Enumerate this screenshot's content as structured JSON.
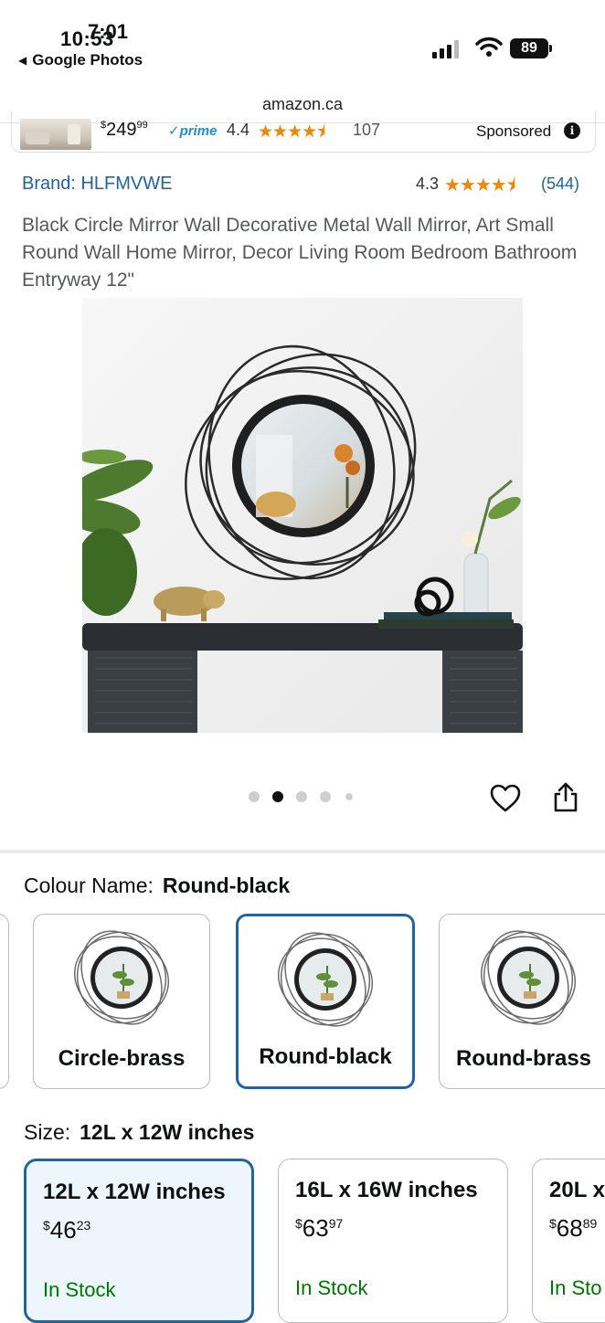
{
  "status_bar": {
    "time_back": "10:53",
    "time_front": "7:01",
    "back_app": "Google Photos",
    "battery": "89"
  },
  "browser": {
    "url": "amazon.ca"
  },
  "sponsored": {
    "price_whole": "249",
    "price_fraction": "99",
    "currency": "$",
    "prime": "✓prime",
    "rating": "4.4",
    "stars": "★★★★⯨",
    "review_count": "107",
    "label": "Sponsored",
    "info_icon": "i"
  },
  "product": {
    "brand": "Brand: HLFMVWE",
    "rating": "4.3",
    "stars": "★★★★⯨",
    "review_count": "(544)",
    "title": "Black Circle Mirror Wall Decorative Metal Wall Mirror, Art Small Round Wall Home Mirror, Decor Living Room Bedroom Bathroom Entryway 12\"",
    "image_index": 2,
    "image_count": 5
  },
  "colour": {
    "label": "Colour Name:",
    "selected": "Round-black",
    "options": [
      {
        "name": "Circle-brass"
      },
      {
        "name": "Round-black"
      },
      {
        "name": "Round-brass"
      }
    ]
  },
  "size": {
    "label": "Size:",
    "selected": "12L x 12W inches",
    "options": [
      {
        "dim": "12L x 12W inches",
        "currency": "$",
        "whole": "46",
        "fraction": "23",
        "stock": "In Stock"
      },
      {
        "dim": "16L x 16W inches",
        "currency": "$",
        "whole": "63",
        "fraction": "97",
        "stock": "In Stock"
      },
      {
        "dim": "20L x",
        "currency": "$",
        "whole": "68",
        "fraction": "89",
        "stock": "In Sto"
      }
    ]
  },
  "colors": {
    "link": "#2162a1",
    "star": "#f08804",
    "stock": "#007600",
    "prime": "#1f8ed1"
  }
}
